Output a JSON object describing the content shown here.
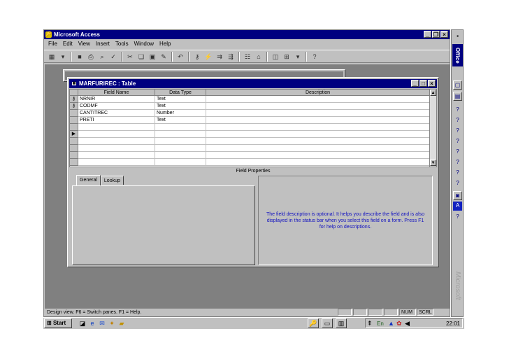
{
  "app": {
    "title": "Microsoft Access",
    "menu": [
      "File",
      "Edit",
      "View",
      "Insert",
      "Tools",
      "Window",
      "Help"
    ]
  },
  "table_window": {
    "title": "MARFURIREC : Table",
    "columns": [
      "Field Name",
      "Data Type",
      "Description"
    ],
    "rows": [
      {
        "field": "NRNIR",
        "type": "Text",
        "key": true
      },
      {
        "field": "CODMF",
        "type": "Text",
        "key": true
      },
      {
        "field": "CANTITREC",
        "type": "Number",
        "key": false
      },
      {
        "field": "PRETI",
        "type": "Text",
        "key": false
      }
    ],
    "field_properties_label": "Field Properties",
    "tabs": [
      "General",
      "Lookup"
    ],
    "help_text": "The field description is optional.  It helps you describe the field and is also displayed in the status bar when you select this field on a form.  Press F1 for help on descriptions."
  },
  "status": {
    "text": "Design view.  F6 = Switch panes.  F1 = Help.",
    "num": "NUM",
    "scrl": "SCRL"
  },
  "office_bar": {
    "title": "Office",
    "brand": "Microsoft"
  },
  "taskbar": {
    "start": "Start",
    "clock": "22:01"
  }
}
